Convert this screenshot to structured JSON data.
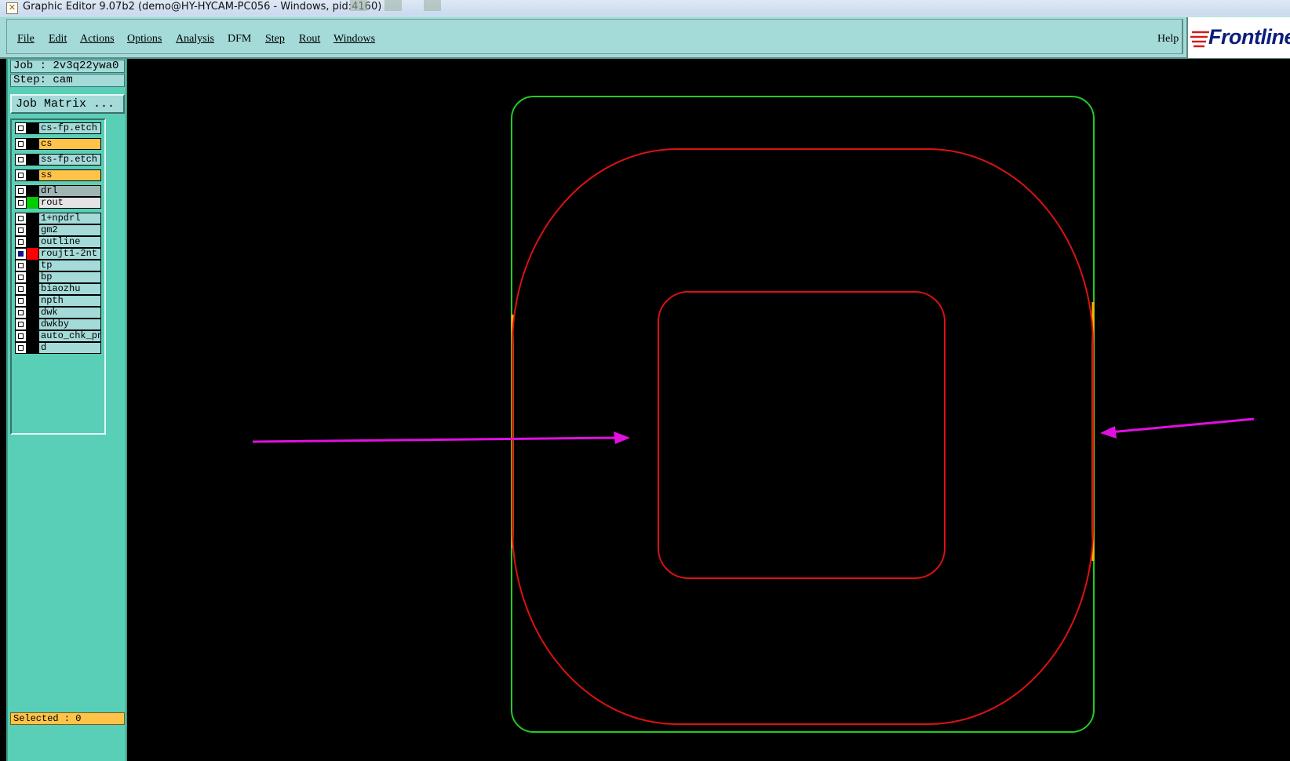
{
  "window": {
    "title": "Graphic Editor 9.07b2 (demo@HY-HYCAM-PC056 - Windows, pid:4160)",
    "icon": "app-x-icon"
  },
  "menubar": {
    "items": [
      {
        "label": "File"
      },
      {
        "label": "Edit"
      },
      {
        "label": "Actions"
      },
      {
        "label": "Options"
      },
      {
        "label": "Analysis"
      },
      {
        "label": "DFM"
      },
      {
        "label": "Step"
      },
      {
        "label": "Rout"
      },
      {
        "label": "Windows"
      }
    ],
    "help": "Help",
    "logo": "Frontline"
  },
  "sidebar": {
    "job_line": "Job : 2v3q22ywa0",
    "step_line": "Step: cam",
    "job_matrix_button": "Job Matrix ...",
    "layers": [
      {
        "name": "cs-fp.etch",
        "label_bg": "#a4dad8",
        "swatch": "#000000",
        "active": false
      },
      {
        "name": "cs",
        "label_bg": "#ffc34a",
        "swatch": "#000000",
        "active": false
      },
      {
        "name": "ss-fp.etch",
        "label_bg": "#a4dad8",
        "swatch": "#000000",
        "active": false
      },
      {
        "name": "ss",
        "label_bg": "#ffc34a",
        "swatch": "#000000",
        "active": false
      },
      {
        "name": "drl",
        "label_bg": "#9fb5b4",
        "swatch": "#000000",
        "active": false
      },
      {
        "name": "rout",
        "label_bg": "#e4e4e4",
        "swatch": "#00cc00",
        "active": false
      },
      {
        "name": "1+npdrl",
        "label_bg": "#a4dad8",
        "swatch": "#000000",
        "active": false
      },
      {
        "name": "gm2",
        "label_bg": "#a4dad8",
        "swatch": "#000000",
        "active": false
      },
      {
        "name": "outline",
        "label_bg": "#a4dad8",
        "swatch": "#000000",
        "active": false
      },
      {
        "name": "roujt1-2nt",
        "label_bg": "#a4dad8",
        "swatch": "#ff0000",
        "active": true
      },
      {
        "name": "tp",
        "label_bg": "#a4dad8",
        "swatch": "#000000",
        "active": false
      },
      {
        "name": "bp",
        "label_bg": "#a4dad8",
        "swatch": "#000000",
        "active": false
      },
      {
        "name": "biaozhu",
        "label_bg": "#a4dad8",
        "swatch": "#000000",
        "active": false
      },
      {
        "name": "npth",
        "label_bg": "#a4dad8",
        "swatch": "#000000",
        "active": false
      },
      {
        "name": "dwk",
        "label_bg": "#a4dad8",
        "swatch": "#000000",
        "active": false
      },
      {
        "name": "dwkby",
        "label_bg": "#a4dad8",
        "swatch": "#000000",
        "active": false
      },
      {
        "name": "auto_chk_pn",
        "label_bg": "#a4dad8",
        "swatch": "#000000",
        "active": false
      },
      {
        "name": "d",
        "label_bg": "#a4dad8",
        "swatch": "#000000",
        "active": false
      }
    ],
    "selected_line": "Selected : 0"
  },
  "colors": {
    "menu_bg": "#a4dad8",
    "panel_bg": "#58cfb6",
    "canvas_bg": "#000000",
    "outline_green": "#22cc22",
    "rout_red": "#dd1111",
    "highlight_orange": "#ffb400",
    "arrow_magenta": "#e010e0"
  }
}
